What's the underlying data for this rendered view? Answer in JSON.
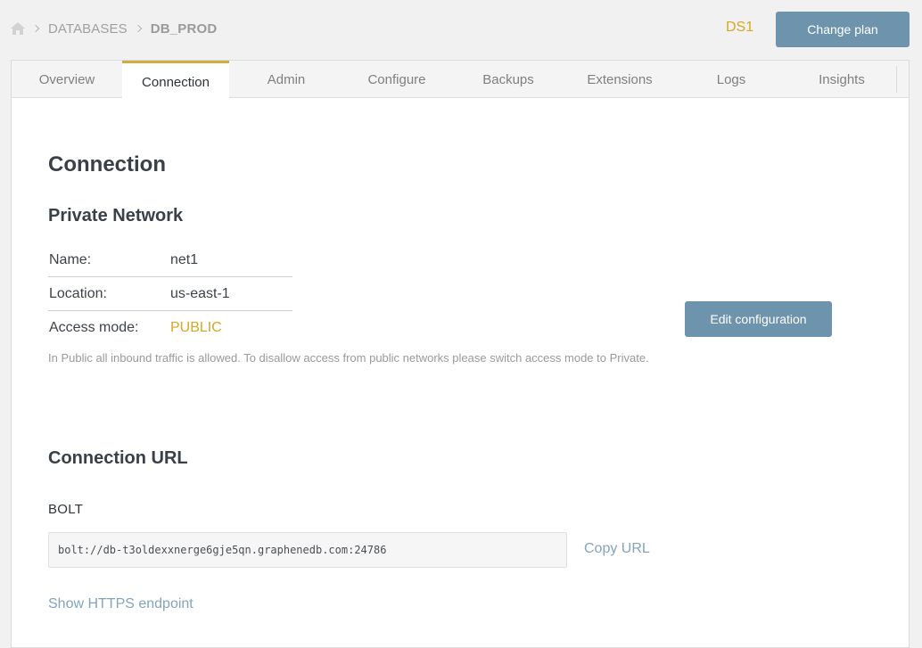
{
  "breadcrumb": {
    "home_icon": "home-icon",
    "items": [
      "DATABASES",
      "DB_PROD"
    ]
  },
  "header": {
    "plan": "DS1",
    "change_plan_label": "Change plan"
  },
  "tabs": [
    {
      "label": "Overview",
      "active": false
    },
    {
      "label": "Connection",
      "active": true
    },
    {
      "label": "Admin",
      "active": false
    },
    {
      "label": "Configure",
      "active": false
    },
    {
      "label": "Backups",
      "active": false
    },
    {
      "label": "Extensions",
      "active": false
    },
    {
      "label": "Logs",
      "active": false
    },
    {
      "label": "Insights",
      "active": false
    }
  ],
  "page": {
    "title": "Connection"
  },
  "private_network": {
    "heading": "Private Network",
    "rows": [
      {
        "label": "Name:",
        "value": "net1"
      },
      {
        "label": "Location:",
        "value": "us-east-1"
      },
      {
        "label": "Access mode:",
        "value": "PUBLIC"
      }
    ],
    "note": "In Public all inbound traffic is allowed. To disallow access from public networks please switch access mode to Private.",
    "edit_button_label": "Edit configuration"
  },
  "connection_url": {
    "heading": "Connection URL",
    "protocol_label": "BOLT",
    "url": "bolt://db-t3oldexxnerge6gje5qn.graphenedb.com:24786",
    "copy_label": "Copy URL",
    "https_link_label": "Show HTTPS endpoint"
  },
  "colors": {
    "accent": "#d7a624",
    "button": "#6e93ad",
    "link": "#84a4bd"
  }
}
